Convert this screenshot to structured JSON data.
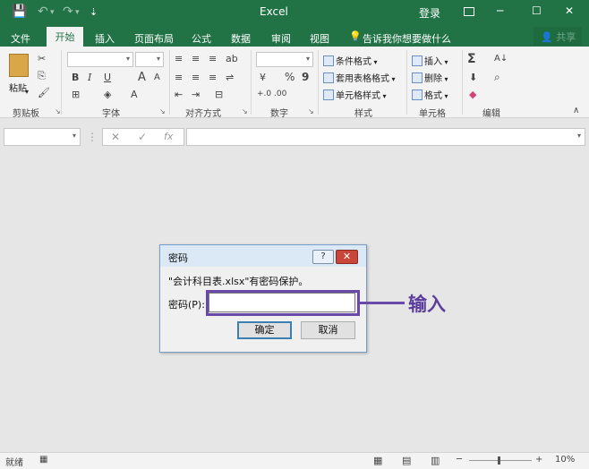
{
  "window": {
    "title": "Excel",
    "login": "登录",
    "ribbon_options_icon": "ribbon-display-options-icon",
    "minimize": "─",
    "maximize": "☐",
    "close": "✕"
  },
  "qat": {
    "save": "💾",
    "undo": "↶",
    "undo_dd": "▾",
    "redo": "↷",
    "redo_dd": "▾",
    "customize": "⇣"
  },
  "tabs": [
    "文件",
    "开始",
    "插入",
    "页面布局",
    "公式",
    "数据",
    "审阅",
    "视图"
  ],
  "active_tab": "开始",
  "tell_me": {
    "icon": "💡",
    "text": "告诉我你想要做什么"
  },
  "share": "共享",
  "ribbon": {
    "clipboard": {
      "label": "剪贴板",
      "paste": "粘贴",
      "cut": "✂",
      "copy": "⎘",
      "format_painter": "🖌"
    },
    "font": {
      "label": "字体",
      "bold": "B",
      "italic": "I",
      "underline": "U",
      "grow": "A",
      "shrink": "A",
      "border": "⊞",
      "fill": "◈",
      "color": "A"
    },
    "alignment": {
      "label": "对齐方式",
      "top": "≡",
      "middle": "≡",
      "bottom": "≡",
      "wrap": "⇌",
      "left": "≡",
      "center": "≡",
      "right": "≡",
      "merge": "⊟",
      "indent_dec": "⇤",
      "indent_inc": "⇥",
      "orient": "ab"
    },
    "number": {
      "label": "数字",
      "percent": "%",
      "comma": "9",
      "currency": "¥",
      "inc_dec": "+.0",
      "dec_dec": ".00"
    },
    "styles": {
      "label": "样式",
      "conditional": "条件格式",
      "table": "套用表格格式",
      "cell_styles": "单元格样式"
    },
    "cells": {
      "label": "单元格",
      "insert": "插入",
      "delete": "删除",
      "format": "格式"
    },
    "editing": {
      "label": "编辑",
      "sum": "Σ",
      "sort": "A↓",
      "fill": "⬇",
      "find": "⌕",
      "clear": "◆"
    }
  },
  "formula_bar": {
    "cancel": "✕",
    "enter": "✓",
    "fx": "fx",
    "dots": "⋮"
  },
  "dialog": {
    "title": "密码",
    "help": "?",
    "close": "✕",
    "message": "\"会计科目表.xlsx\"有密码保护。",
    "password_label": "密码(P):",
    "password_value": "",
    "ok": "确定",
    "cancel": "取消"
  },
  "annotation": {
    "text": "输入",
    "color": "#6a4aa8"
  },
  "status": {
    "ready": "就绪",
    "zoom": "10%",
    "minus": "─",
    "plus": "+"
  },
  "colors": {
    "excel_green": "#217346",
    "ribbon_bg": "#f3f3f3",
    "workspace": "#e6e6e6"
  }
}
